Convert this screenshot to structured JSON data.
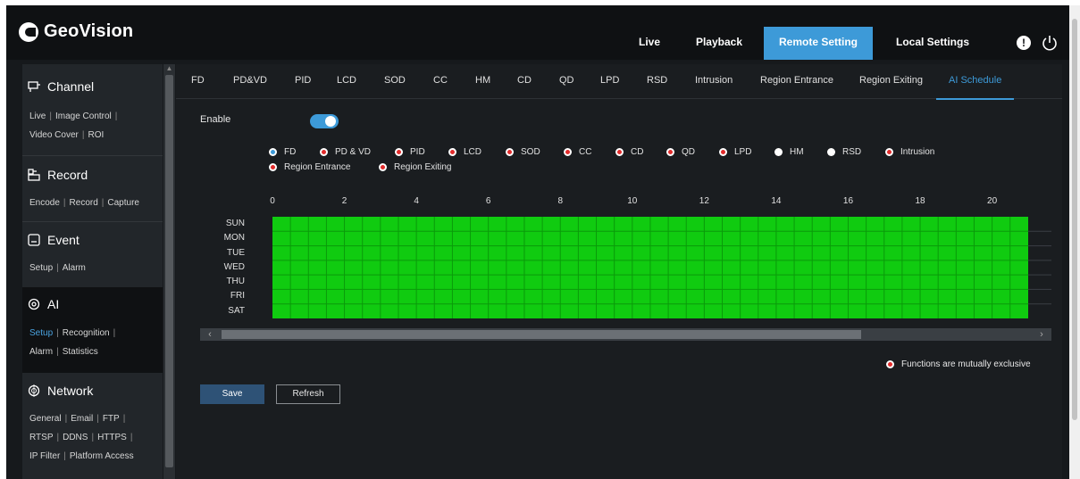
{
  "brand": "GeoVision",
  "nav": {
    "live": "Live",
    "playback": "Playback",
    "remote_setting": "Remote Setting",
    "local_settings": "Local Settings"
  },
  "sidebar": {
    "channel": {
      "title": "Channel",
      "links": [
        "Live",
        "Image Control",
        "Video Cover",
        "ROI"
      ]
    },
    "record": {
      "title": "Record",
      "links": [
        "Encode",
        "Record",
        "Capture"
      ]
    },
    "event": {
      "title": "Event",
      "links": [
        "Setup",
        "Alarm"
      ]
    },
    "ai": {
      "title": "AI",
      "links": [
        "Setup",
        "Recognition",
        "Alarm",
        "Statistics"
      ]
    },
    "network": {
      "title": "Network",
      "links": [
        "General",
        "Email",
        "FTP",
        "RTSP",
        "DDNS",
        "HTTPS",
        "IP Filter",
        "Platform Access"
      ]
    }
  },
  "subtabs": [
    "FD",
    "PD&VD",
    "PID",
    "LCD",
    "SOD",
    "CC",
    "HM",
    "CD",
    "QD",
    "LPD",
    "RSD",
    "Intrusion",
    "Region Entrance",
    "Region Exiting",
    "AI Schedule"
  ],
  "active_subtab": "AI Schedule",
  "enable_label": "Enable",
  "enable_on": true,
  "legend": [
    {
      "label": "FD",
      "state": "selected"
    },
    {
      "label": "PD & VD",
      "state": "exclusive"
    },
    {
      "label": "PID",
      "state": "exclusive"
    },
    {
      "label": "LCD",
      "state": "exclusive"
    },
    {
      "label": "SOD",
      "state": "exclusive"
    },
    {
      "label": "CC",
      "state": "exclusive"
    },
    {
      "label": "CD",
      "state": "exclusive"
    },
    {
      "label": "QD",
      "state": "exclusive"
    },
    {
      "label": "LPD",
      "state": "exclusive"
    },
    {
      "label": "HM",
      "state": "available"
    },
    {
      "label": "RSD",
      "state": "available"
    },
    {
      "label": "Intrusion",
      "state": "exclusive"
    },
    {
      "label": "Region Entrance",
      "state": "exclusive"
    },
    {
      "label": "Region Exiting",
      "state": "exclusive"
    }
  ],
  "schedule": {
    "hour_ticks": [
      "0",
      "2",
      "4",
      "6",
      "8",
      "10",
      "12",
      "14",
      "16",
      "18",
      "20"
    ],
    "days": [
      "SUN",
      "MON",
      "TUE",
      "WED",
      "THU",
      "FRI",
      "SAT"
    ],
    "scheduled_color": "#10cb10"
  },
  "note": "Functions are mutually exclusive",
  "buttons": {
    "save": "Save",
    "refresh": "Refresh"
  },
  "colors": {
    "accent": "#3d9ad8",
    "exclusive": "#e22b2b"
  }
}
